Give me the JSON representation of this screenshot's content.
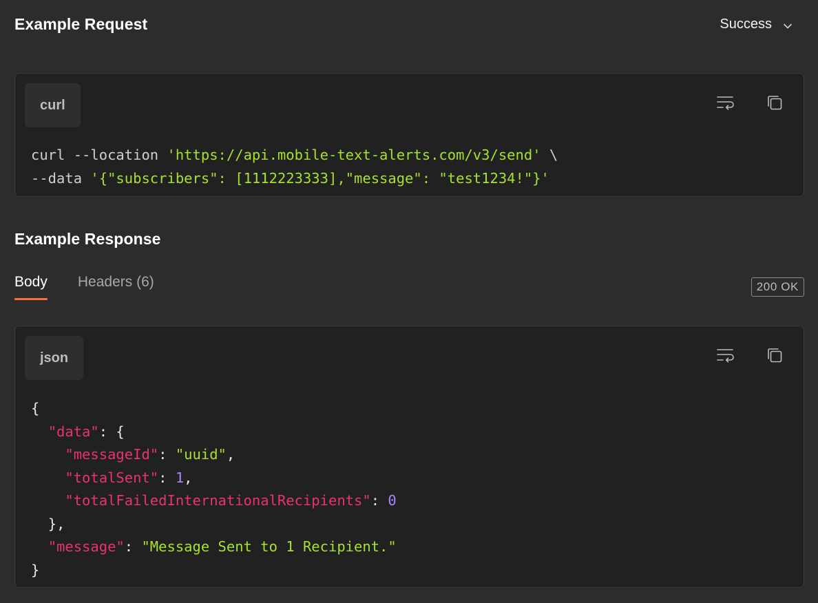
{
  "request": {
    "title": "Example Request",
    "example_selector": "Success",
    "language": "curl",
    "code_lines": [
      [
        {
          "t": "plain",
          "v": "curl --location "
        },
        {
          "t": "str",
          "v": "'https://api.mobile-text-alerts.com/v3/send'"
        },
        {
          "t": "plain",
          "v": " \\"
        }
      ],
      [
        {
          "t": "plain",
          "v": "--data "
        },
        {
          "t": "str",
          "v": "'{\"subscribers\": [1112223333],\"message\": \"test1234!\"}'"
        }
      ]
    ]
  },
  "response": {
    "title": "Example Response",
    "tabs": [
      {
        "label": "Body",
        "active": true
      },
      {
        "label": "Headers (6)",
        "active": false
      }
    ],
    "status": "200 OK",
    "language": "json",
    "code_lines": [
      [
        {
          "t": "pun",
          "v": "{"
        }
      ],
      [
        {
          "t": "plain",
          "v": "  "
        },
        {
          "t": "key",
          "v": "\"data\""
        },
        {
          "t": "pun",
          "v": ": {"
        }
      ],
      [
        {
          "t": "plain",
          "v": "    "
        },
        {
          "t": "key",
          "v": "\"messageId\""
        },
        {
          "t": "pun",
          "v": ": "
        },
        {
          "t": "str",
          "v": "\"uuid\""
        },
        {
          "t": "pun",
          "v": ","
        }
      ],
      [
        {
          "t": "plain",
          "v": "    "
        },
        {
          "t": "key",
          "v": "\"totalSent\""
        },
        {
          "t": "pun",
          "v": ": "
        },
        {
          "t": "num",
          "v": "1"
        },
        {
          "t": "pun",
          "v": ","
        }
      ],
      [
        {
          "t": "plain",
          "v": "    "
        },
        {
          "t": "key",
          "v": "\"totalFailedInternationalRecipients\""
        },
        {
          "t": "pun",
          "v": ": "
        },
        {
          "t": "num",
          "v": "0"
        }
      ],
      [
        {
          "t": "plain",
          "v": "  "
        },
        {
          "t": "pun",
          "v": "},"
        }
      ],
      [
        {
          "t": "plain",
          "v": "  "
        },
        {
          "t": "key",
          "v": "\"message\""
        },
        {
          "t": "pun",
          "v": ": "
        },
        {
          "t": "str",
          "v": "\"Message Sent to 1 Recipient.\""
        }
      ],
      [
        {
          "t": "pun",
          "v": "}"
        }
      ]
    ]
  },
  "icons": {
    "selector_chevron": "chevron-down-icon",
    "wrap": "wrap-lines-icon",
    "copy": "copy-icon"
  },
  "colors": {
    "background": "#2c2c2c",
    "panel": "#212121",
    "accent": "#ff6c37",
    "string": "#a6e22e",
    "key": "#e8336d",
    "number": "#ae81ff"
  }
}
